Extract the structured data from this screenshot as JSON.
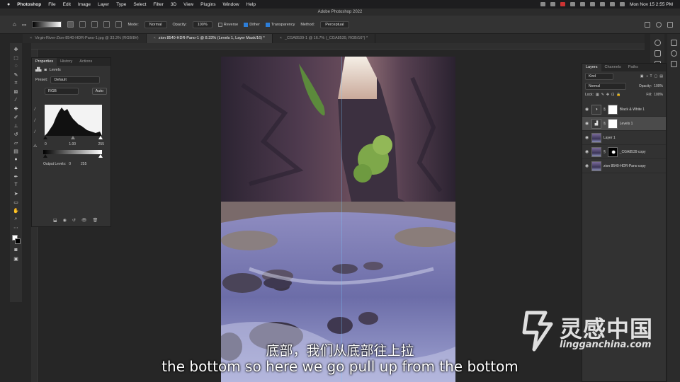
{
  "menubar": {
    "app": "Photoshop",
    "items": [
      "File",
      "Edit",
      "Image",
      "Layer",
      "Type",
      "Select",
      "Filter",
      "3D",
      "View",
      "Plugins",
      "Window",
      "Help"
    ],
    "datetime": "Mon Nov 15  2:55 PM"
  },
  "window": {
    "title": "Adobe Photoshop 2022"
  },
  "options": {
    "mode_label": "Mode:",
    "mode_value": "Normal",
    "opacity_label": "Opacity:",
    "opacity_value": "100%",
    "reverse": "Reverse",
    "dither": "Dither",
    "transparency": "Transparency",
    "method_label": "Method:",
    "method_value": "Perceptual"
  },
  "tabs": [
    {
      "label": "Virgin-River-Zion-8540-HDR-Pano-1.jpg @ 33.3% (RGB/8#)",
      "active": false
    },
    {
      "label": "zion 8540-HDR-Pano-1 @ 8.33% (Levels 1, Layer Mask/16) *",
      "active": true
    },
    {
      "label": "_CGA8539-1 @ 16.7% (_CGA8539, RGB/16*) *",
      "active": false
    }
  ],
  "properties": {
    "tabs": [
      "Properties",
      "History",
      "Actions"
    ],
    "header": "Levels",
    "preset_label": "Preset:",
    "preset_value": "Default",
    "channel": "RGB",
    "auto": "Auto",
    "input_black": "0",
    "input_gamma": "1.00",
    "input_white": "255",
    "output_label": "Output Levels:",
    "output_black": "0",
    "output_white": "255"
  },
  "layers": {
    "tabs": [
      "Layers",
      "Channels",
      "Paths"
    ],
    "kind": "Kind",
    "blend": "Normal",
    "opacity_label": "Opacity:",
    "opacity_value": "100%",
    "lock_label": "Lock:",
    "fill_label": "Fill:",
    "fill_value": "100%",
    "items": [
      {
        "name": "Black & White 1",
        "type": "adjustment",
        "selected": false
      },
      {
        "name": "Levels 1",
        "type": "adjustment",
        "selected": true
      },
      {
        "name": "Layer 1",
        "type": "pixel",
        "selected": false
      },
      {
        "name": "_CGA8539 copy",
        "type": "masked",
        "selected": false
      },
      {
        "name": "zion 8540-HDR-Pano copy",
        "type": "pixel",
        "selected": false
      }
    ]
  },
  "subtitles": {
    "zh": "底部，我们从底部往上拉",
    "en": "the bottom so here we go pull up from the bottom"
  },
  "watermark": {
    "cn": "灵感中国",
    "en": "lingganchina.com"
  }
}
